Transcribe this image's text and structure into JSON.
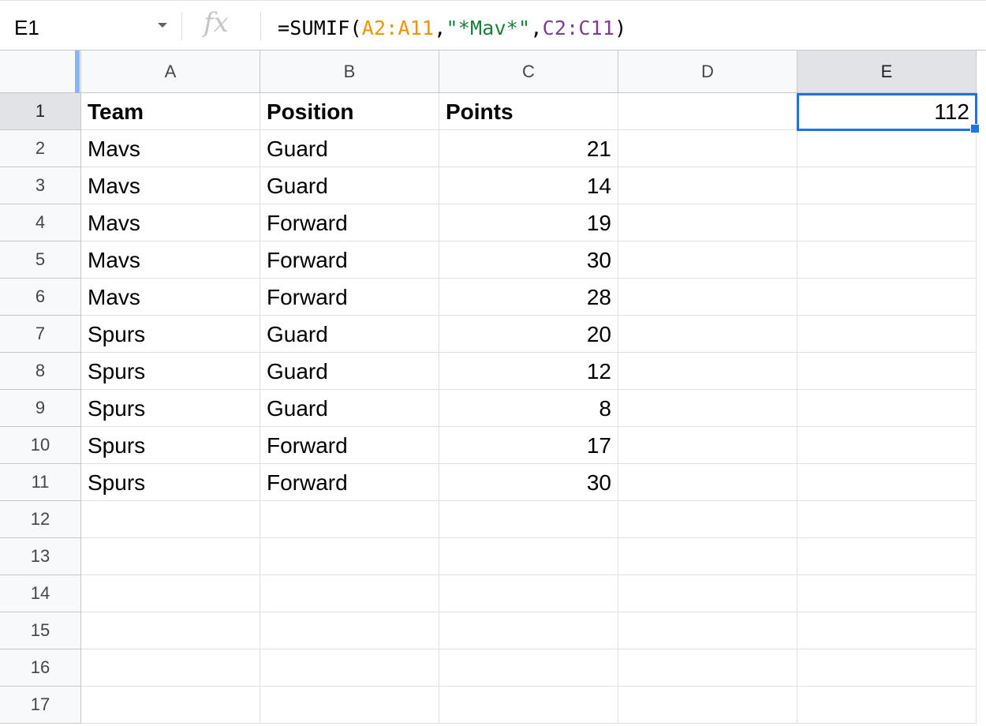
{
  "name_box": {
    "value": "E1"
  },
  "formula_bar": {
    "fx_label": "fx",
    "formula": {
      "prefix": "=SUMIF(",
      "range1": "A2:A11",
      "sep1": ",",
      "criteria": "\"*Mav*\"",
      "sep2": ",",
      "range2": "C2:C11",
      "suffix": ")"
    }
  },
  "colors": {
    "range1": "#f09300",
    "criteria": "#188038",
    "range2": "#7d3c98",
    "selection": "#1a73e8"
  },
  "columns": [
    "A",
    "B",
    "C",
    "D",
    "E"
  ],
  "selected_column": "E",
  "rows": [
    "1",
    "2",
    "3",
    "4",
    "5",
    "6",
    "7",
    "8",
    "9",
    "10",
    "11",
    "12",
    "13",
    "14",
    "15",
    "16",
    "17"
  ],
  "selected_row": "1",
  "headers": {
    "team": "Team",
    "position": "Position",
    "points": "Points"
  },
  "data": [
    {
      "team": "Mavs",
      "position": "Guard",
      "points": "21"
    },
    {
      "team": "Mavs",
      "position": "Guard",
      "points": "14"
    },
    {
      "team": "Mavs",
      "position": "Forward",
      "points": "19"
    },
    {
      "team": "Mavs",
      "position": "Forward",
      "points": "30"
    },
    {
      "team": "Mavs",
      "position": "Forward",
      "points": "28"
    },
    {
      "team": "Spurs",
      "position": "Guard",
      "points": "20"
    },
    {
      "team": "Spurs",
      "position": "Guard",
      "points": "12"
    },
    {
      "team": "Spurs",
      "position": "Guard",
      "points": "8"
    },
    {
      "team": "Spurs",
      "position": "Forward",
      "points": "17"
    },
    {
      "team": "Spurs",
      "position": "Forward",
      "points": "30"
    }
  ],
  "result": {
    "cell": "E1",
    "value": "112"
  }
}
